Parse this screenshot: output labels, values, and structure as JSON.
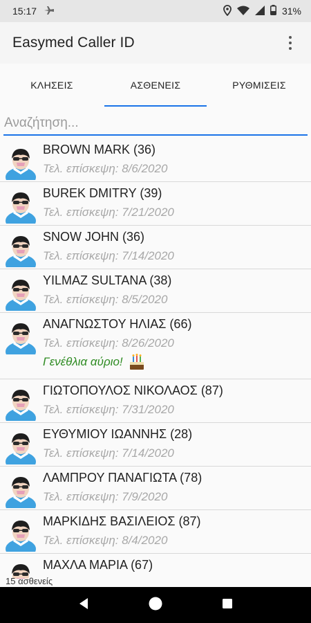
{
  "status_bar": {
    "time": "15:17",
    "battery": "31%"
  },
  "app_bar": {
    "title": "Easymed Caller ID",
    "overflow_icon": "more-vert-icon"
  },
  "tabs": [
    {
      "label": "ΚΛΗΣΕΙΣ",
      "active": false
    },
    {
      "label": "ΑΣΘΕΝΕΙΣ",
      "active": true
    },
    {
      "label": "ΡΥΘΜΙΣΕΙΣ",
      "active": false
    }
  ],
  "search": {
    "placeholder": "Αναζήτηση...",
    "value": ""
  },
  "patients": [
    {
      "name": "BROWN MARK (36)",
      "visit": "Τελ. επίσκεψη: 8/6/2020"
    },
    {
      "name": "BUREK DMITRY (39)",
      "visit": "Τελ. επίσκεψη: 7/21/2020"
    },
    {
      "name": "SNOW JOHN (36)",
      "visit": "Τελ. επίσκεψη: 7/14/2020"
    },
    {
      "name": "YILMAZ SULTANA (38)",
      "visit": "Τελ. επίσκεψη: 8/5/2020"
    },
    {
      "name": "ΑΝΑΓΝΩΣΤΟΥ ΗΛΙΑΣ (66)",
      "visit": "Τελ. επίσκεψη: 8/26/2020",
      "birthday": "Γενέθλια αύριο!"
    },
    {
      "name": "ΓΙΩΤΟΠΟΥΛΟΣ ΝΙΚΟΛΑΟΣ (87)",
      "visit": "Τελ. επίσκεψη: 7/31/2020"
    },
    {
      "name": "ΕΥΘΥΜΙΟΥ ΙΩΑΝΝΗΣ (28)",
      "visit": "Τελ. επίσκεψη: 7/14/2020"
    },
    {
      "name": "ΛΑΜΠΡΟΥ ΠΑΝΑΓΙΩΤΑ (78)",
      "visit": "Τελ. επίσκεψη: 7/9/2020"
    },
    {
      "name": "ΜΑΡΚΙΔΗΣ ΒΑΣΙΛΕΙΟΣ (87)",
      "visit": "Τελ. επίσκεψη: 8/4/2020"
    },
    {
      "name": "ΜΑΧΛΑ ΜΑΡΙΑ (67)",
      "visit": ""
    }
  ],
  "footer": {
    "count_label": "15 ασθενείς"
  },
  "colors": {
    "accent": "#1a73e8",
    "birthday_text": "#2e8b22",
    "secondary_text": "#a8a8a8"
  },
  "icons": {
    "avatar": "patient-avatar-icon",
    "cake": "birthday-cake-icon",
    "back": "nav-back-icon",
    "home": "nav-home-icon",
    "recents": "nav-recents-icon"
  }
}
